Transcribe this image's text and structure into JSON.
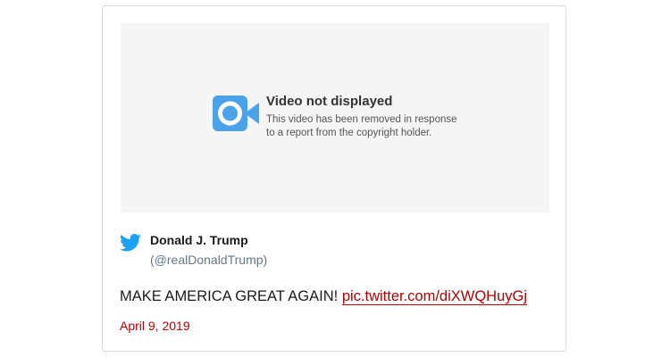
{
  "media": {
    "icon": "video-camera-icon",
    "title": "Video not displayed",
    "body_line1": "This video has been removed in response",
    "body_line2": "to a report from the copyright holder."
  },
  "tweet": {
    "platform_icon": "twitter-bird-icon",
    "author_name": "Donald J. Trump",
    "author_handle": "(@realDonaldTrump)",
    "text": "MAKE AMERICA GREAT AGAIN!",
    "link_text": "pic.twitter.com/diXWQHuyGj",
    "date": "April 9, 2019"
  },
  "colors": {
    "video_icon": "#4aa3e8",
    "twitter_blue": "#1da1f2",
    "link": "#b40000",
    "date": "#c00000",
    "media_bg": "#f5f5f5"
  }
}
